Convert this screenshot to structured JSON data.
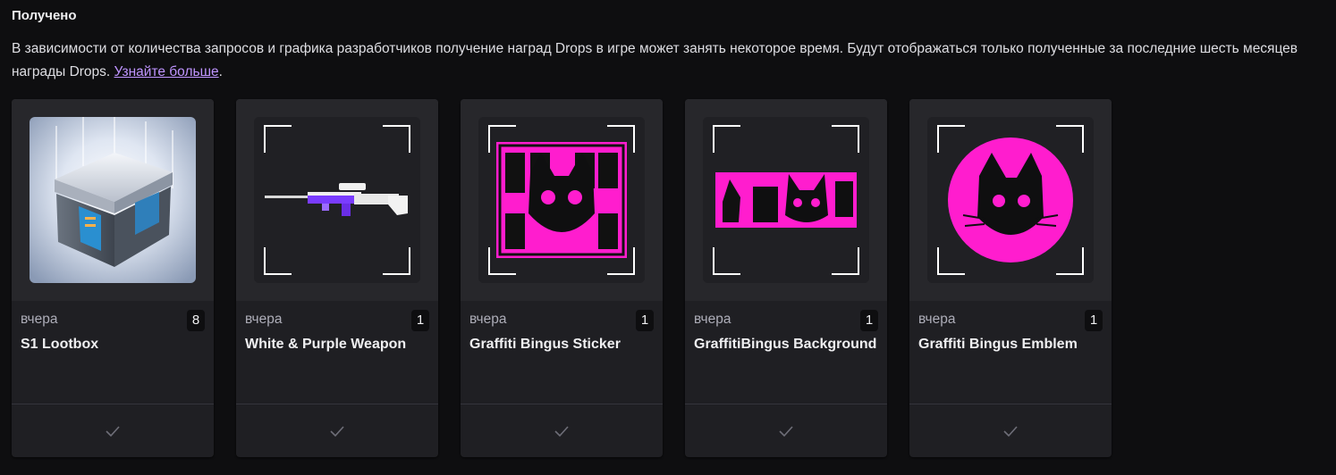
{
  "section": {
    "title": "Получено",
    "description_text": "В зависимости от количества запросов и графика разработчиков получение наград Drops в игре может занять некоторое время. Будут отображаться только полученные за последние шесть месяцев награды Drops. ",
    "learn_more_link": "Узнайте больше",
    "period": "."
  },
  "colors": {
    "background": "#0e0e10",
    "card": "#1f1f23",
    "link": "#bf94ff",
    "accent_pink": "#ff1dce"
  },
  "cards": [
    {
      "date": "вчера",
      "count": "8",
      "name": "S1 Lootbox",
      "image_icon": "lootbox-image"
    },
    {
      "date": "вчера",
      "count": "1",
      "name": "White & Purple Weapon",
      "image_icon": "rifle-image"
    },
    {
      "date": "вчера",
      "count": "1",
      "name": "Graffiti Bingus Sticker",
      "image_icon": "sticker-image"
    },
    {
      "date": "вчера",
      "count": "1",
      "name": "GraffitiBingus Background",
      "image_icon": "background-image"
    },
    {
      "date": "вчера",
      "count": "1",
      "name": "Graffiti Bingus Emblem",
      "image_icon": "emblem-image"
    }
  ]
}
